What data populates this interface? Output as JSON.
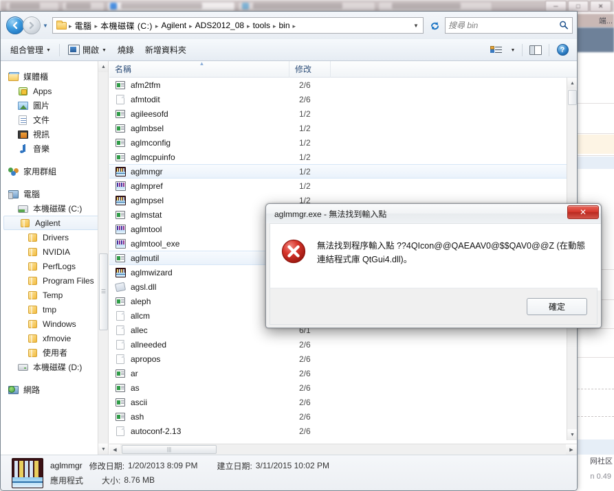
{
  "background": {
    "tabs_blurred": true,
    "window_controls": [
      "minimize",
      "maximize",
      "close"
    ],
    "right_panel_text_1": "端...",
    "right_panel_text_2": "网社区",
    "right_panel_text_3": "n 0.49"
  },
  "explorer": {
    "nav": {
      "back_label": "上一頁",
      "forward_label": "下一頁",
      "history_label": "最近的位置",
      "refresh_label": "重新整理"
    },
    "breadcrumb": {
      "folder_icon": "folder-icon",
      "items": [
        "電腦",
        "本機磁碟 (C:)",
        "Agilent",
        "ADS2012_08",
        "tools",
        "bin"
      ],
      "separator": "▸",
      "dropdown": "▼"
    },
    "search": {
      "placeholder": "搜尋 bin",
      "value": "",
      "icon": "search-icon"
    },
    "toolbar": {
      "organize_label": "組合管理",
      "open_label": "開啟",
      "burn_label": "燒錄",
      "new_folder_label": "新增資料夾",
      "caret": "▼",
      "view_icon": "view-options-icon",
      "pane_icon": "preview-pane-icon",
      "help_icon": "help-icon",
      "help_glyph": "?"
    },
    "navpane": {
      "groups": [
        {
          "items": [
            {
              "label": "媒體櫃",
              "icon": "library-icon",
              "indent": 0
            },
            {
              "label": "Apps",
              "icon": "apps-icon",
              "indent": 1
            },
            {
              "label": "圖片",
              "icon": "pictures-icon",
              "indent": 1
            },
            {
              "label": "文件",
              "icon": "documents-icon",
              "indent": 1
            },
            {
              "label": "視訊",
              "icon": "videos-icon",
              "indent": 1
            },
            {
              "label": "音樂",
              "icon": "music-icon",
              "indent": 1
            }
          ]
        },
        {
          "items": [
            {
              "label": "家用群組",
              "icon": "homegroup-icon",
              "indent": 0
            }
          ]
        },
        {
          "items": [
            {
              "label": "電腦",
              "icon": "computer-icon",
              "indent": 0
            },
            {
              "label": "本機磁碟 (C:)",
              "icon": "local-disk-icon",
              "indent": 1
            },
            {
              "label": "Agilent",
              "icon": "folder-icon",
              "indent": 2,
              "selected": true
            },
            {
              "label": "Drivers",
              "icon": "folder-icon",
              "indent": 2
            },
            {
              "label": "NVIDIA",
              "icon": "folder-icon",
              "indent": 2
            },
            {
              "label": "PerfLogs",
              "icon": "folder-icon",
              "indent": 2
            },
            {
              "label": "Program Files",
              "icon": "folder-icon",
              "indent": 2
            },
            {
              "label": "Temp",
              "icon": "folder-icon",
              "indent": 2
            },
            {
              "label": "tmp",
              "icon": "folder-icon",
              "indent": 2
            },
            {
              "label": "Windows",
              "icon": "folder-icon",
              "indent": 2
            },
            {
              "label": "xfmovie",
              "icon": "folder-icon",
              "indent": 2
            },
            {
              "label": "使用者",
              "icon": "folder-icon",
              "indent": 2
            },
            {
              "label": "本機磁碟 (D:)",
              "icon": "drive-icon",
              "indent": 1
            }
          ]
        },
        {
          "items": [
            {
              "label": "網路",
              "icon": "network-icon",
              "indent": 0
            }
          ]
        }
      ]
    },
    "filelist": {
      "columns": [
        {
          "key": "name",
          "label": "名稱",
          "sorted": true
        },
        {
          "key": "modified",
          "label": "修改"
        }
      ],
      "rows": [
        {
          "name": "afm2tfm",
          "modified": "2/6",
          "icon": "exe-icon"
        },
        {
          "name": "afmtodit",
          "modified": "2/6",
          "icon": "file-icon"
        },
        {
          "name": "agileesofd",
          "modified": "1/2",
          "icon": "exe-icon"
        },
        {
          "name": "aglmbsel",
          "modified": "1/2",
          "icon": "exe-icon"
        },
        {
          "name": "aglmconfig",
          "modified": "1/2",
          "icon": "exe-icon"
        },
        {
          "name": "aglmcpuinfo",
          "modified": "1/2",
          "icon": "exe-icon"
        },
        {
          "name": "aglmmgr",
          "modified": "1/2",
          "icon": "waveform-app-icon",
          "selected": true
        },
        {
          "name": "aglmpref",
          "modified": "1/2",
          "icon": "waveform-icon"
        },
        {
          "name": "aglmpsel",
          "modified": "1/2",
          "icon": "waveform-app-icon"
        },
        {
          "name": "aglmstat",
          "modified": "",
          "icon": "exe-icon"
        },
        {
          "name": "aglmtool",
          "modified": "",
          "icon": "waveform-icon"
        },
        {
          "name": "aglmtool_exe",
          "modified": "",
          "icon": "waveform-icon"
        },
        {
          "name": "aglmutil",
          "modified": "",
          "icon": "exe-icon",
          "focused": true
        },
        {
          "name": "aglmwizard",
          "modified": "",
          "icon": "waveform-app-icon"
        },
        {
          "name": "agsl.dll",
          "modified": "",
          "icon": "dll-icon"
        },
        {
          "name": "aleph",
          "modified": "",
          "icon": "exe-icon"
        },
        {
          "name": "allcm",
          "modified": "",
          "icon": "file-icon"
        },
        {
          "name": "allec",
          "modified": "6/1",
          "icon": "file-icon"
        },
        {
          "name": "allneeded",
          "modified": "2/6",
          "icon": "file-icon"
        },
        {
          "name": "apropos",
          "modified": "2/6",
          "icon": "file-icon"
        },
        {
          "name": "ar",
          "modified": "2/6",
          "icon": "exe-icon"
        },
        {
          "name": "as",
          "modified": "2/6",
          "icon": "exe-icon"
        },
        {
          "name": "ascii",
          "modified": "2/6",
          "icon": "exe-icon"
        },
        {
          "name": "ash",
          "modified": "2/6",
          "icon": "exe-icon"
        },
        {
          "name": "autoconf-2.13",
          "modified": "2/6",
          "icon": "file-icon"
        }
      ]
    },
    "details": {
      "icon": "waveform-app-icon",
      "name": "aglmmgr",
      "modified_key": "修改日期:",
      "modified_value": "1/20/2013 8:09 PM",
      "created_key": "建立日期:",
      "created_value": "3/11/2015 10:02 PM",
      "type": "應用程式",
      "size_key": "大小:",
      "size_value": "8.76 MB"
    }
  },
  "dialog": {
    "title": "aglmmgr.exe - 無法找到輸入點",
    "close_label": "✕",
    "icon": "error-icon",
    "message": "無法找到程序輸入點 ??4QIcon@@QAEAAV0@$$QAV0@@Z (在動態連結程式庫 QtGui4.dll)。",
    "ok_label": "確定"
  },
  "colors": {
    "error_red": "#cc2222",
    "close_red": "#d4372c",
    "selection_blue": "#eaf2fb",
    "header_text": "#30507a"
  }
}
